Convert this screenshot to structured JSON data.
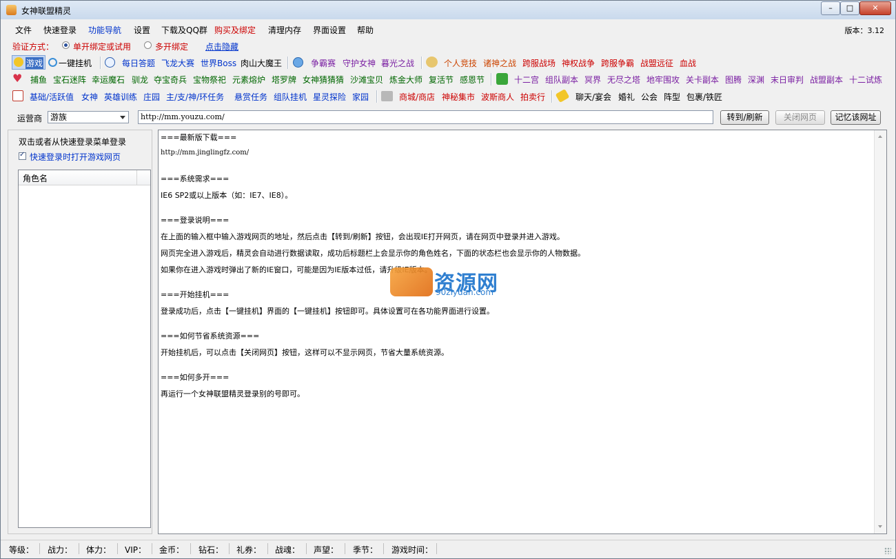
{
  "window": {
    "title": "女神联盟精灵"
  },
  "menu": {
    "items": [
      "文件",
      "快速登录",
      "功能导航",
      "设置",
      "下载及QQ群",
      "购买及绑定",
      "清理内存",
      "界面设置",
      "帮助"
    ],
    "version": "版本：3.12"
  },
  "verify": {
    "label": "验证方式：",
    "option1": "单开绑定或试用",
    "option2": "多开绑定",
    "hide_link": "点击隐藏"
  },
  "toolbar1": {
    "game_btn": "游戏",
    "oneclick": "一键挂机",
    "daily": [
      "每日答题",
      "飞龙大赛",
      "世界Boss",
      "肉山大魔王"
    ],
    "battle": [
      "争霸赛",
      "守护女神",
      "暮光之战"
    ],
    "arena": [
      "个人竞技",
      "诸神之战",
      "跨服战场",
      "神权战争",
      "跨服争霸",
      "战盟远征",
      "血战"
    ]
  },
  "toolbar2": {
    "left": [
      "捕鱼",
      "宝石迷阵",
      "幸运魔石",
      "驯龙",
      "夺宝奇兵",
      "宝物祭祀",
      "元素熔炉",
      "塔罗牌",
      "女神猜猜猜",
      "沙滩宝贝",
      "炼金大师",
      "复活节",
      "感恩节"
    ],
    "right": [
      "十二宫",
      "组队副本",
      "冥界",
      "无尽之塔",
      "地牢围攻",
      "关卡副本",
      "图腾",
      "深渊",
      "末日审判",
      "战盟副本",
      "十二试炼"
    ]
  },
  "toolbar3": {
    "left": [
      "基础/活跃值",
      "女神",
      "英雄训练",
      "庄园",
      "主/支/神/环任务",
      "悬赏任务",
      "组队挂机",
      "星灵探险",
      "家园"
    ],
    "shop": [
      "商城/商店",
      "神秘集市",
      "波斯商人",
      "拍卖行"
    ],
    "social": [
      "聊天/宴会",
      "婚礼",
      "公会",
      "阵型",
      "包裹/铁匠"
    ]
  },
  "address": {
    "operator_label": "运营商",
    "operator_value": "游族",
    "url": "http://mm.youzu.com/",
    "goto_btn": "转到/刷新",
    "close_btn": "关闭网页",
    "remember_btn": "记忆该网址"
  },
  "left_panel": {
    "hint": "双击或者从快速登录菜单登录",
    "checkbox_label": "快速登录时打开游戏网页",
    "column_header": "角色名"
  },
  "content": {
    "lines": [
      "===最新版下载===",
      "http://mm.jinglingfz.com/",
      "===系统需求===",
      "IE6 SP2或以上版本（如：IE7、IE8）。",
      "===登录说明===",
      "在上面的输入框中输入游戏网页的地址，然后点击【转到/刷新】按钮，会出现IE打开网页，请在网页中登录并进入游戏。",
      "网页完全进入游戏后，精灵会自动进行数据读取，成功后标题栏上会显示你的角色姓名，下面的状态栏也会显示你的人物数据。",
      "如果你在进入游戏时弹出了新的IE窗口，可能是因为IE版本过低，请升级IE版本。",
      "===开始挂机===",
      "登录成功后，点击【一键挂机】界面的【一键挂机】按钮即可。具体设置可在各功能界面进行设置。",
      "===如何节省系统资源===",
      "开始挂机后，可以点击【关闭网页】按钮，这样可以不显示网页，节省大量系统资源。",
      "===如何多开===",
      "再运行一个女神联盟精灵登录别的号即可。"
    ],
    "watermark_text": "资源网",
    "watermark_sub": "90ziyuan.com"
  },
  "status": [
    "等级：",
    "战力：",
    "体力：",
    "VIP：",
    "金币：",
    "钻石：",
    "礼券：",
    "战魂：",
    "声望：",
    "季节：",
    "游戏时间："
  ],
  "colors": {
    "link_blue": "#0033cc",
    "green": "#006600",
    "red": "#cc0000",
    "purple": "#7a1fa2"
  }
}
